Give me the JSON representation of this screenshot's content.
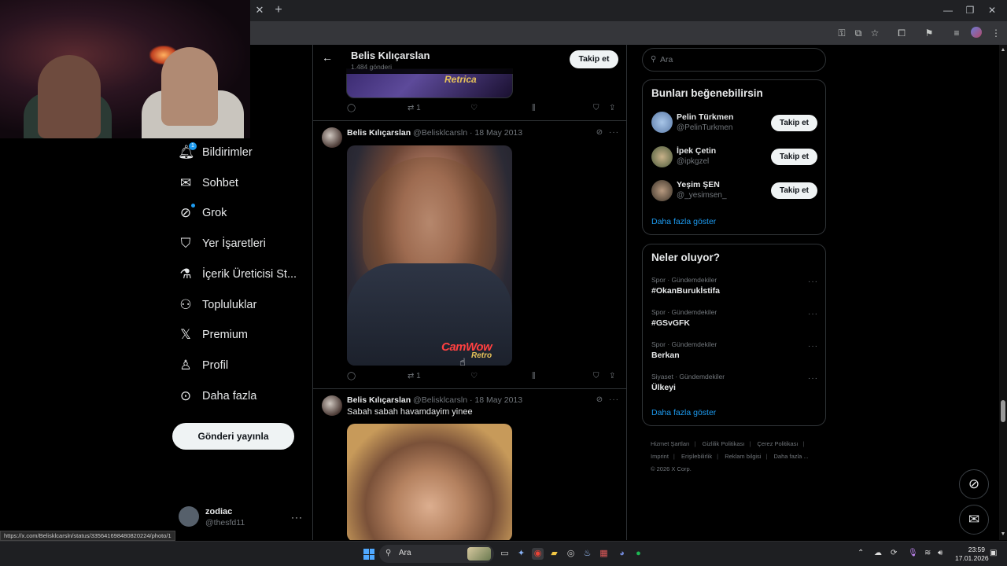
{
  "browser": {
    "tab_close_icon": "close-icon",
    "new_tab_icon": "plus-icon",
    "window_controls": [
      "minimize-icon",
      "maximize-icon",
      "close-icon"
    ],
    "status_url": "https://x.com/Belisklcarsln/status/335641698480820224/photo/1"
  },
  "nav": {
    "items": [
      {
        "label": "Bildirimler",
        "icon": "bell-icon",
        "badge": "1"
      },
      {
        "label": "Sohbet",
        "icon": "mail-icon"
      },
      {
        "label": "Grok",
        "icon": "grok-icon"
      },
      {
        "label": "Yer İşaretleri",
        "icon": "bookmark-icon"
      },
      {
        "label": "İçerik Üreticisi St...",
        "icon": "flask-icon"
      },
      {
        "label": "Topluluklar",
        "icon": "people-icon"
      },
      {
        "label": "Premium",
        "icon": "x-logo-icon"
      },
      {
        "label": "Profil",
        "icon": "person-icon"
      },
      {
        "label": "Daha fazla",
        "icon": "more-circle-icon"
      }
    ],
    "post_button": "Gönderi yayınla",
    "account": {
      "name": "zodiac",
      "handle": "@thesfd11",
      "more": "···"
    }
  },
  "profile_header": {
    "name": "Belis Kılıçarslan",
    "post_count": "1.484 gönderi",
    "follow_label": "Takip et"
  },
  "top_image": {
    "overlay_text": "Retrica"
  },
  "tweets": [
    {
      "actions": {
        "reply": "",
        "retweet": "1",
        "like": "",
        "views": ""
      }
    },
    {
      "author": "Belis Kılıçarslan",
      "handle": "@Belisklcarsln",
      "date": "· 18 May 2013",
      "text": "",
      "watermark": "CamWow",
      "watermark_sub": "Retro",
      "actions": {
        "reply": "",
        "retweet": "1",
        "like": "",
        "views": ""
      }
    },
    {
      "author": "Belis Kılıçarslan",
      "handle": "@Belisklcarsln",
      "date": "· 18 May 2013",
      "text": "Sabah sabah havamdayim yinee"
    }
  ],
  "search": {
    "placeholder": "Ara"
  },
  "who_to_follow": {
    "title": "Bunları beğenebilirsin",
    "users": [
      {
        "name": "Pelin Türkmen",
        "handle": "@PelinTurkmen",
        "button": "Takip et"
      },
      {
        "name": "İpek Çetin",
        "handle": "@ipkgzel",
        "button": "Takip et"
      },
      {
        "name": "Yeşim ŞEN",
        "handle": "@_yesimsen_",
        "button": "Takip et"
      }
    ],
    "show_more": "Daha fazla göster"
  },
  "trends": {
    "title": "Neler oluyor?",
    "items": [
      {
        "category": "Spor · Gündemdekiler",
        "name": "#OkanBurukİstifa"
      },
      {
        "category": "Spor · Gündemdekiler",
        "name": "#GSvGFK"
      },
      {
        "category": "Spor · Gündemdekiler",
        "name": "Berkan"
      },
      {
        "category": "Siyaset · Gündemdekiler",
        "name": "Ülkeyi"
      }
    ],
    "show_more": "Daha fazla göster"
  },
  "footer": {
    "links": [
      "Hizmet Şartları",
      "Gizlilik Politikası",
      "Çerez Politikası",
      "Imprint",
      "Erişilebilirlik",
      "Reklam bilgisi",
      "Daha fazla ..."
    ],
    "copyright": "© 2026 X Corp."
  },
  "taskbar": {
    "search_text": "Ara",
    "time": "23:59",
    "date": "17.01.2026"
  },
  "colors": {
    "accent": "#1d9bf0",
    "background": "#000000",
    "text": "#e7e9ea",
    "muted": "#71767b"
  }
}
